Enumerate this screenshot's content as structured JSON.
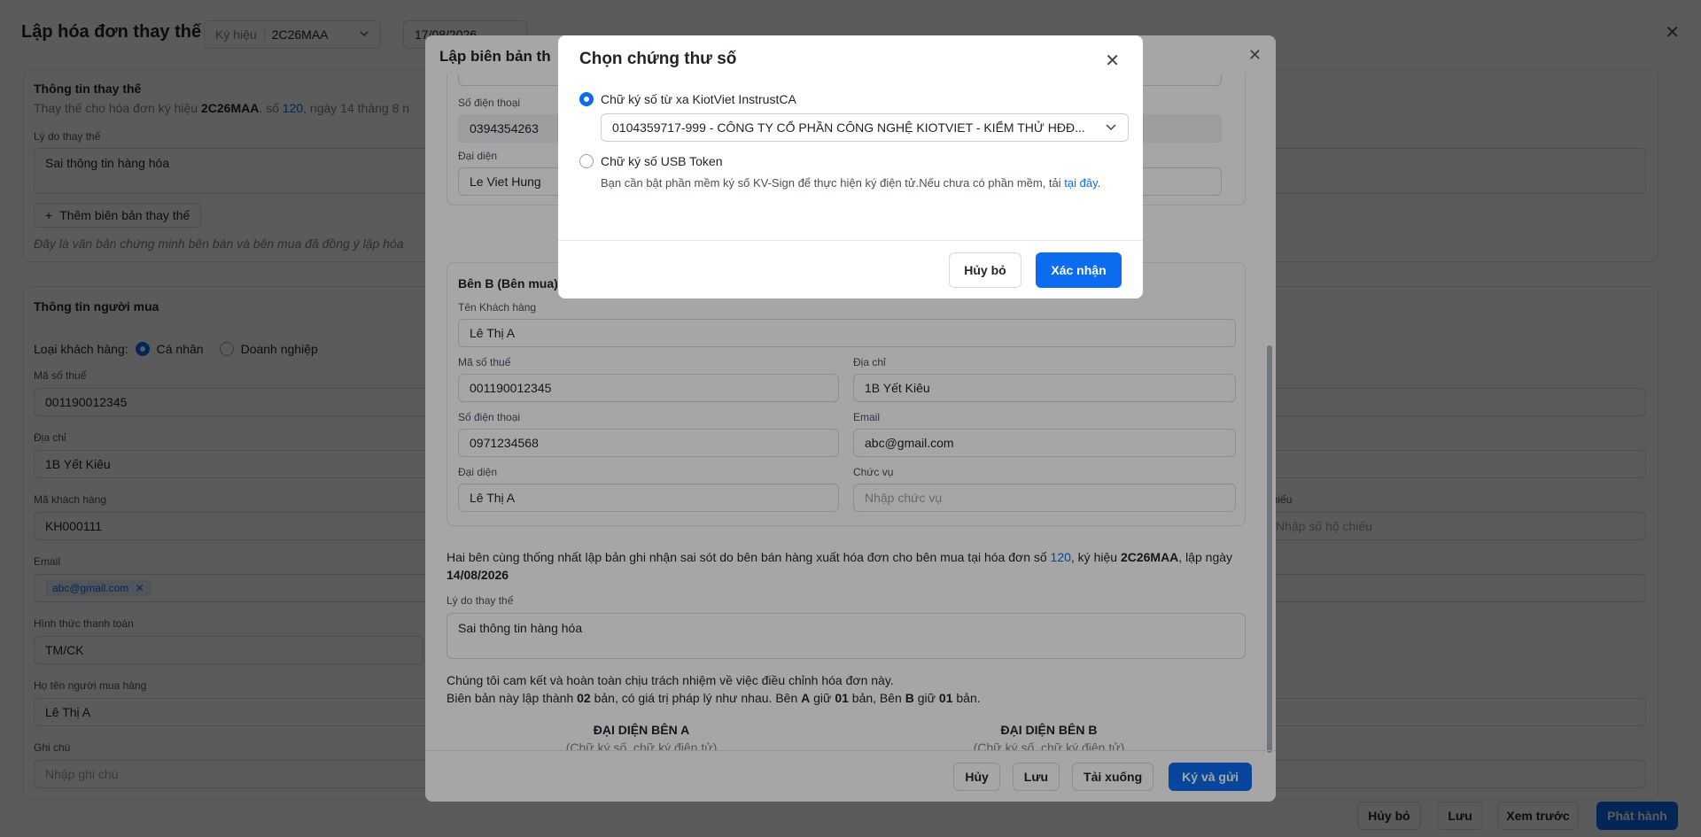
{
  "page": {
    "title": "Lập hóa đơn thay thế",
    "symbol_label": "Ký hiệu",
    "symbol_value": "2C26MAA",
    "date_value": "17/08/2026",
    "replace_section": {
      "title": "Thông tin thay thế",
      "desc_prefix": "Thay thế cho hóa đơn ký hiệu",
      "desc_symbol": "2C26MAA",
      "desc_no_prefix": ", số",
      "desc_no": "120",
      "desc_suffix": ", ngày 14 tháng 8 n",
      "reason_label": "Lý do thay thế",
      "reason_value": "Sai thông tin hàng hóa",
      "add_button": "Thêm biên bản thay thế",
      "note": "Đây là văn bản chứng minh bên bán và bên mua đã đồng ý lập hóa"
    },
    "buyer_section": {
      "title": "Thông tin người mua",
      "customer_type_label": "Loại khách hàng:",
      "type_individual": "Cá nhân",
      "type_business": "Doanh nghiệp",
      "tax_label": "Mã số thuế",
      "tax_value": "001190012345",
      "address_label": "Địa chỉ",
      "address_value": "1B Yết Kiêu",
      "customer_code_label": "Mã khách hàng",
      "customer_code_value": "KH000111",
      "passport_label": "hộ chiếu",
      "passport_placeholder": "Nhập số hộ chiếu",
      "email_label": "Email",
      "email_tag": "abc@gmail.com",
      "payment_label": "Hình thức thanh toán",
      "payment_value": "TM/CK",
      "buyer_name_label": "Họ tên người mua hàng",
      "buyer_name_value": "Lê Thị A",
      "note_label": "Ghi chú",
      "note_placeholder": "Nhập ghi chú"
    },
    "footer": {
      "cancel": "Hủy bỏ",
      "save": "Lưu",
      "preview": "Xem trước",
      "issue": "Phát hành"
    }
  },
  "report": {
    "title": "Lập biên bản th",
    "party_a": {
      "phone_label": "Số điện thoại",
      "phone_value": "0394354263",
      "rep_label": "Đại diện",
      "rep_value": "Le Viet Hung"
    },
    "party_b": {
      "title": "Bên B (Bên mua)",
      "customer_name_label": "Tên Khách hàng",
      "customer_name_value": "Lê Thị A",
      "tax_label": "Mã số thuế",
      "tax_value": "001190012345",
      "address_label": "Địa chỉ",
      "address_value": "1B Yết Kiêu",
      "phone_label": "Số điện thoại",
      "phone_value": "0971234568",
      "email_label": "Email",
      "email_value": "abc@gmail.com",
      "rep_label": "Đại diện",
      "rep_value": "Lê Thị A",
      "position_label": "Chức vụ",
      "position_placeholder": "Nhập chức vụ"
    },
    "agreement": {
      "text1": "Hai bên cùng thống nhất lập bản ghi nhận sai sót do bên bán hàng xuất hóa đơn cho bên mua tại hóa đơn số",
      "invoice_no": "120",
      "text2": ", ký hiệu",
      "symbol": "2C26MAA",
      "text3": ", lập",
      "text4": "ngày",
      "date": "14/08/2026"
    },
    "reason_label": "Lý do thay thế",
    "reason_value": "Sai thông tin hàng hóa",
    "commit_line1": "Chúng tôi cam kết và hoàn toàn chịu trách nhiệm về việc điều chỉnh hóa đơn này.",
    "commit_line2_a": "Biên bản này lập thành",
    "commit_copies": "02",
    "commit_line2_b": "bản, có giá trị pháp lý như nhau. Bên",
    "commit_a": "A",
    "commit_line2_c": "giữ",
    "commit_a_copies": "01",
    "commit_line2_d": "bản, Bên",
    "commit_b": "B",
    "commit_line2_e": "giữ",
    "commit_b_copies": "01",
    "commit_line2_f": "bản.",
    "sign_a_title": "ĐẠI DIỆN BÊN A",
    "sign_a_sub": "(Chữ ký số, chữ ký điện tử)",
    "sign_b_title": "ĐẠI DIỆN BÊN B",
    "sign_b_sub": "(Chữ ký số, chữ ký điện tử)",
    "footer": {
      "cancel": "Hủy",
      "save": "Lưu",
      "download": "Tải xuống",
      "sign_send": "Ký và gửi"
    }
  },
  "cert_dialog": {
    "title": "Chọn chứng thư số",
    "option_remote_label": "Chữ ký số từ xa KiotViet InstrustCA",
    "option_remote_value": "0104359717-999 - CÔNG TY CỔ PHẦN CÔNG NGHỆ KIOTVIET - KIỂM THỬ HĐĐ...",
    "option_usb_label": "Chữ ký số USB Token",
    "usb_note": "Bạn cần bật phần mềm ký số KV-Sign để thực hiện ký điện tử.Nếu chưa có phần mềm, tải",
    "usb_link": "tại đây",
    "usb_note_end": ".",
    "cancel": "Hủy bỏ",
    "confirm": "Xác nhận"
  },
  "colors": {
    "primary": "#0b6cf0",
    "overlay": "#000000"
  }
}
